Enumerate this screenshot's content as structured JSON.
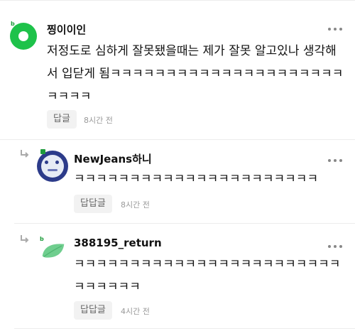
{
  "comments": [
    {
      "author": "찡이이인",
      "badge": "b",
      "text": "저정도로 심하게 잘못됐을때는 제가 잘못 알고있나 생각해서 입닫게 됨ㅋㅋㅋㅋㅋㅋㅋㅋㅋㅋㅋㅋㅋㅋㅋㅋㅋㅋㅋㅋㅋㅋㅋㅋㅋ",
      "reply_label": "답글",
      "time": "8시간 전",
      "avatar_icon": "green-ring-avatar-icon"
    },
    {
      "author": "NewJeans하니",
      "badge": "",
      "text": "ㅋㅋㅋㅋㅋㅋㅋㅋㅋㅋㅋㅋㅋㅋㅋㅋㅋㅋㅋㅋㅋㅋ",
      "reply_label": "답답글",
      "time": "8시간 전",
      "avatar_icon": "bunny-photo-avatar-icon"
    },
    {
      "author": "388195_return",
      "badge": "b",
      "text": "ㅋㅋㅋㅋㅋㅋㅋㅋㅋㅋㅋㅋㅋㅋㅋㅋㅋㅋㅋㅋㅋㅋㅋㅋㅋㅋㅋㅋㅋㅋ",
      "reply_label": "답답글",
      "time": "4시간 전",
      "avatar_icon": "leaf-avatar-icon"
    }
  ],
  "icons": {
    "more": "more-options-icon",
    "reply_arrow": "reply-arrow-icon"
  },
  "colors": {
    "badge_green": "#1e9b3b",
    "avatar_green": "#1ec24a",
    "leaf_green": "#6fce8e"
  }
}
